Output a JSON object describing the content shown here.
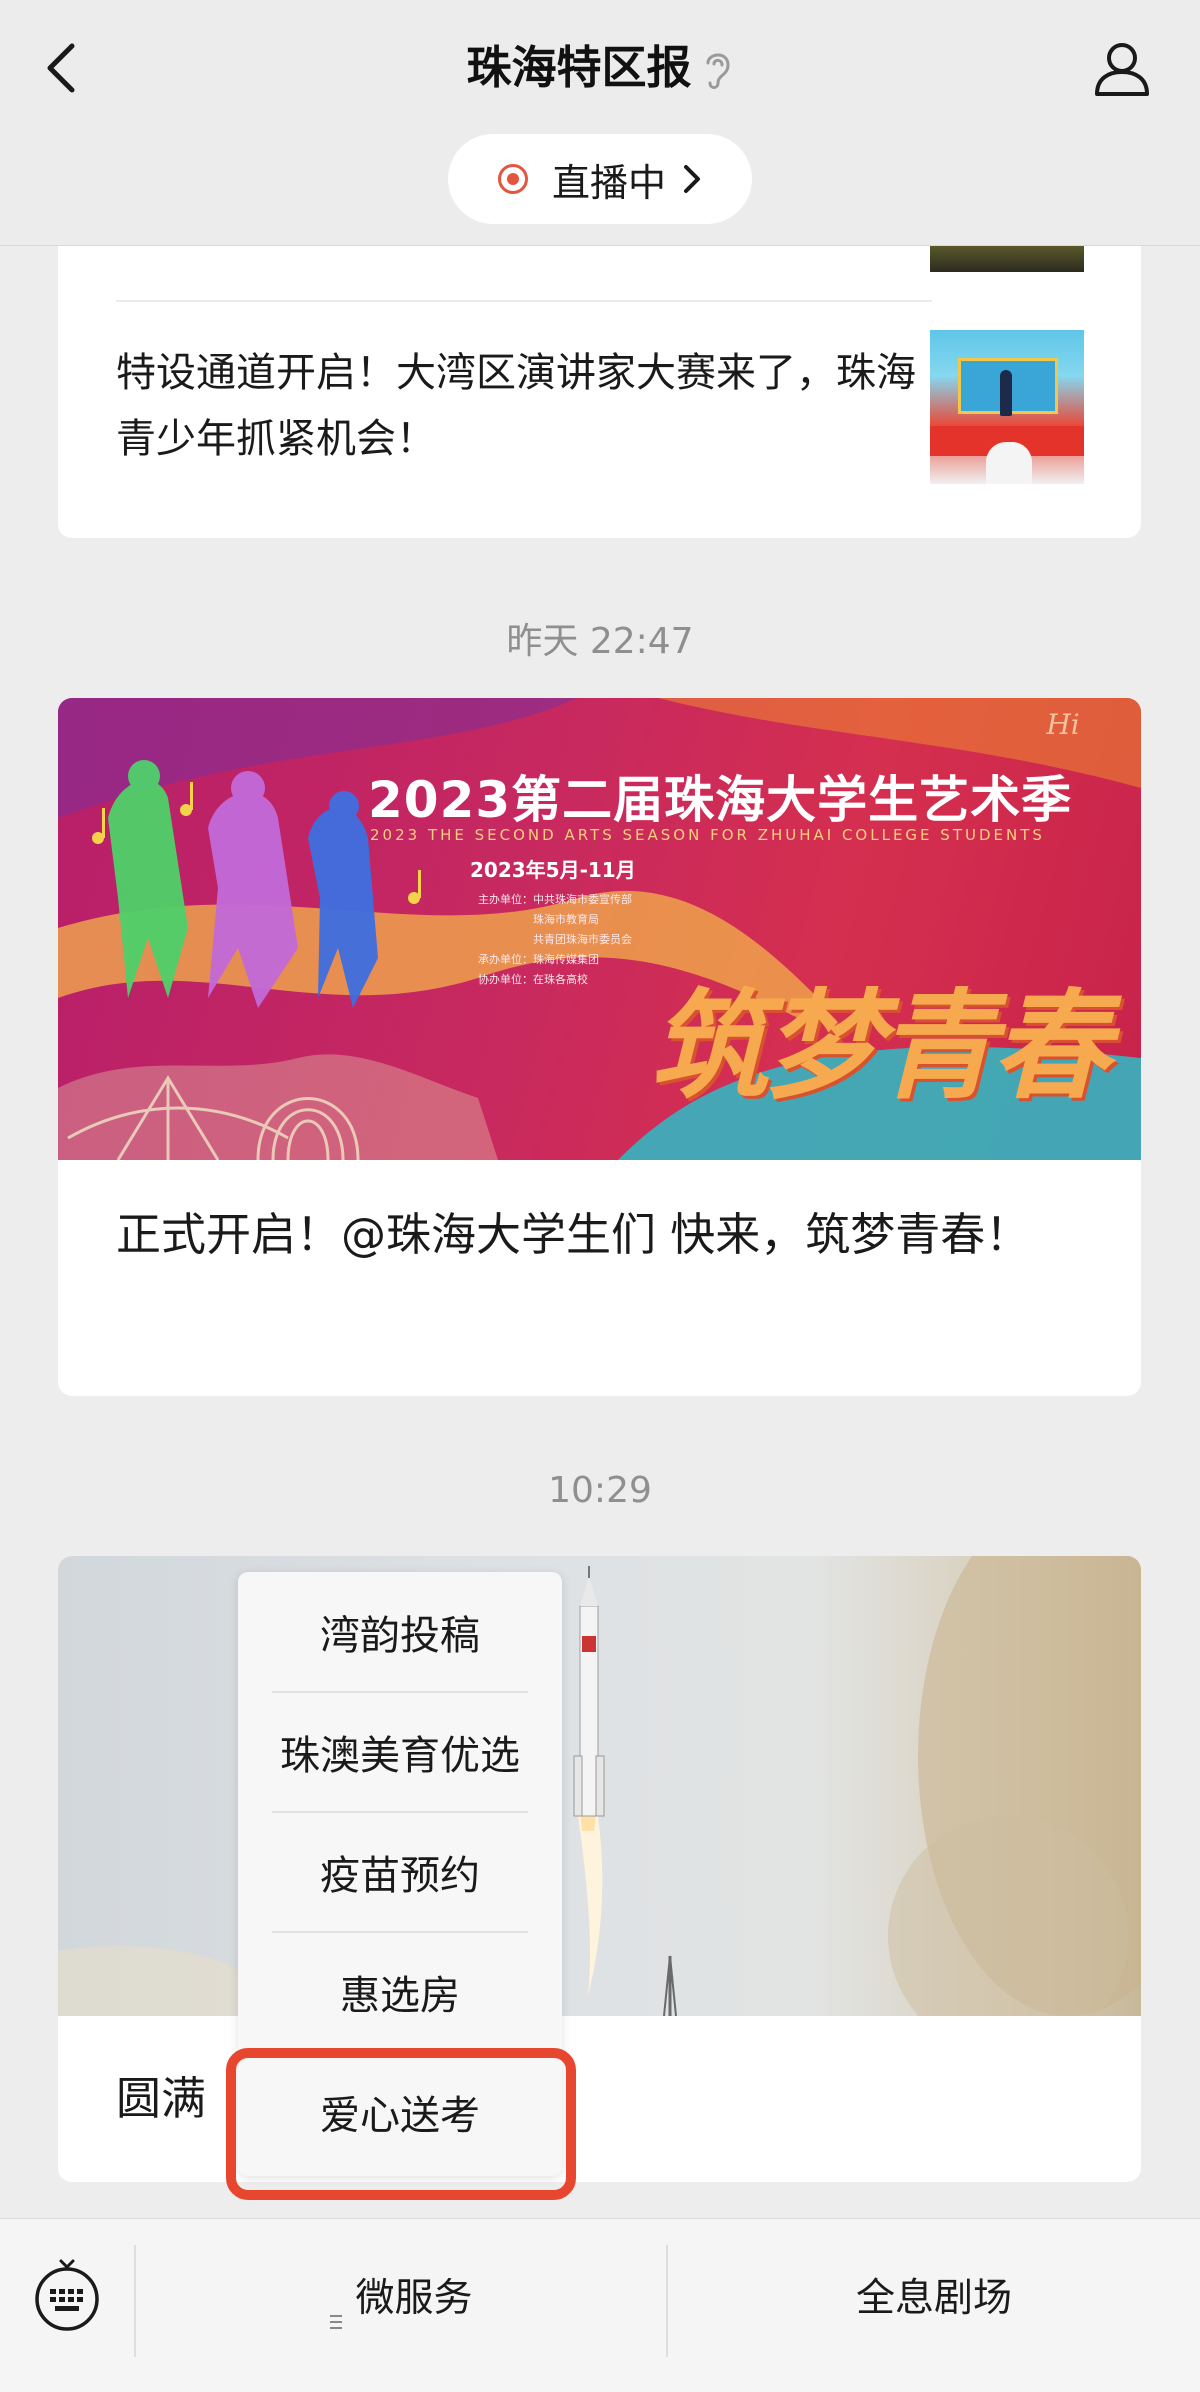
{
  "header": {
    "title": "珠海特区报",
    "live_label": "直播中"
  },
  "feed": {
    "article1_title": "特设通道开启！大湾区演讲家大赛来了，珠海青少年抓紧机会！",
    "timestamp1": "昨天 22:47",
    "article2": {
      "banner_title": "2023第二届珠海大学生艺术季",
      "banner_subtitle": "2023 THE SECOND ARTS SEASON FOR ZHUHAI COLLEGE STUDENTS",
      "banner_date": "2023年5月-11月",
      "banner_organizers": "主办单位：中共珠海市委宣传部\n　　　　　珠海市教育局\n　　　　　共青团珠海市委员会\n承办单位：珠海传媒集团\n协办单位：在珠各高校",
      "banner_slogan": "筑梦青春",
      "banner_logo": "Hi",
      "title": "正式开启！@珠海大学生们 快来，筑梦青春！"
    },
    "timestamp2": "10:29",
    "article3_title_visible": "圆满"
  },
  "popup_menu": {
    "items": [
      "湾韵投稿",
      "珠澳美育优选",
      "疫苗预约",
      "惠选房",
      "爱心送考"
    ],
    "highlighted_item": "爱心送考"
  },
  "bottom_bar": {
    "tab1": "微服务",
    "tab2": "全息剧场"
  },
  "colors": {
    "accent_red": "#e8472f",
    "live_dot": "#e5543f"
  },
  "icons": [
    "back-icon",
    "ear-icon",
    "profile-icon",
    "live-dot-icon",
    "chevron-right-icon",
    "keyboard-icon",
    "menu-icon"
  ]
}
